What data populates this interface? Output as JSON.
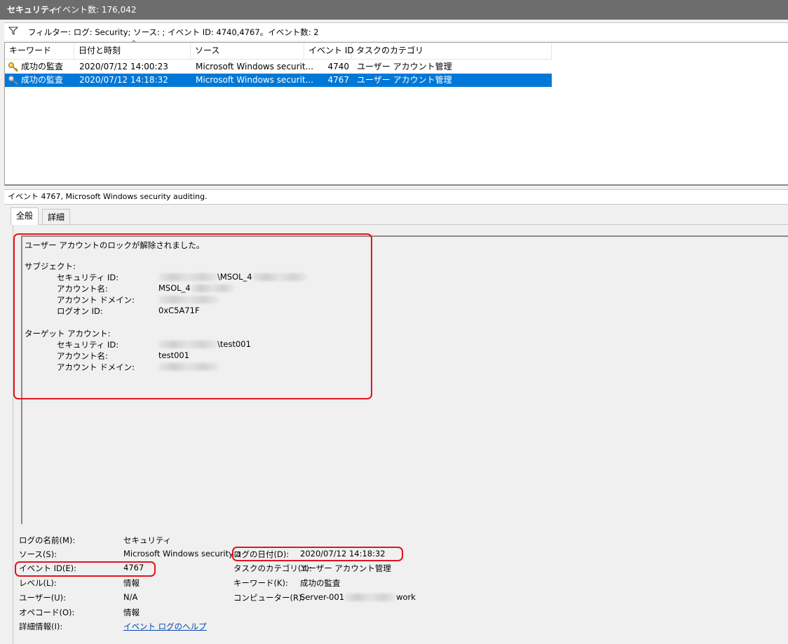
{
  "window": {
    "title": "セキュリティ",
    "event_count": "イベント数: 176,042"
  },
  "filter": {
    "icon": "filter-icon",
    "text": "フィルター: ログ: Security; ソース: ; イベント ID: 4740,4767。イベント数: 2"
  },
  "list": {
    "columns": [
      "キーワード",
      "日付と時刻",
      "ソース",
      "イベント ID",
      "タスクのカテゴリ"
    ],
    "rows": [
      {
        "icon": "key-icon",
        "keyword": "成功の監査",
        "datetime": "2020/07/12 14:00:23",
        "source": "Microsoft Windows securit...",
        "event_id": "4740",
        "category": "ユーザー アカウント管理",
        "selected": false
      },
      {
        "icon": "key-icon",
        "keyword": "成功の監査",
        "datetime": "2020/07/12 14:18:32",
        "source": "Microsoft Windows securit...",
        "event_id": "4767",
        "category": "ユーザー アカウント管理",
        "selected": true
      }
    ]
  },
  "detail": {
    "title": "イベント 4767, Microsoft Windows security auditing.",
    "tabs": [
      "全般",
      "詳細"
    ],
    "message": {
      "headline": "ユーザー アカウントのロックが解除されました。",
      "subject_heading": "サブジェクト:",
      "subject": {
        "security_id_label": "セキュリティ ID:",
        "security_id_value": "\\MSOL_4",
        "account_name_label": "アカウント名:",
        "account_name_value": "MSOL_4",
        "account_domain_label": "アカウント ドメイン:",
        "logon_id_label": "ログオン ID:",
        "logon_id_value": "0xC5A71F"
      },
      "target_heading": "ターゲット アカウント:",
      "target": {
        "security_id_label": "セキュリティ ID:",
        "security_id_value": "\\test001",
        "account_name_label": "アカウント名:",
        "account_name_value": "test001",
        "account_domain_label": "アカウント ドメイン:"
      }
    },
    "properties": {
      "log_name_label": "ログの名前(M):",
      "log_name_value": "セキュリティ",
      "source_label": "ソース(S):",
      "source_value": "Microsoft Windows security a",
      "logged_label": "ログの日付(D):",
      "logged_value": "2020/07/12 14:18:32",
      "event_id_label": "イベント ID(E):",
      "event_id_value": "4767",
      "task_category_label": "タスクのカテゴリ(Y):",
      "task_category_value": "ユーザー アカウント管理",
      "level_label": "レベル(L):",
      "level_value": "情報",
      "keywords_label": "キーワード(K):",
      "keywords_value": "成功の監査",
      "user_label": "ユーザー(U):",
      "user_value": "N/A",
      "computer_label": "コンピューター(R):",
      "computer_value_start": "Server-001",
      "computer_value_end": "work",
      "opcode_label": "オペコード(O):",
      "opcode_value": "情報",
      "more_info_label": "詳細情報(I):",
      "more_info_link": "イベント ログのヘルプ"
    }
  },
  "colors": {
    "selection": "#0078d7",
    "highlight_box": "#e3141b",
    "titlebar": "#6d6d6d",
    "link": "#0645ad"
  }
}
